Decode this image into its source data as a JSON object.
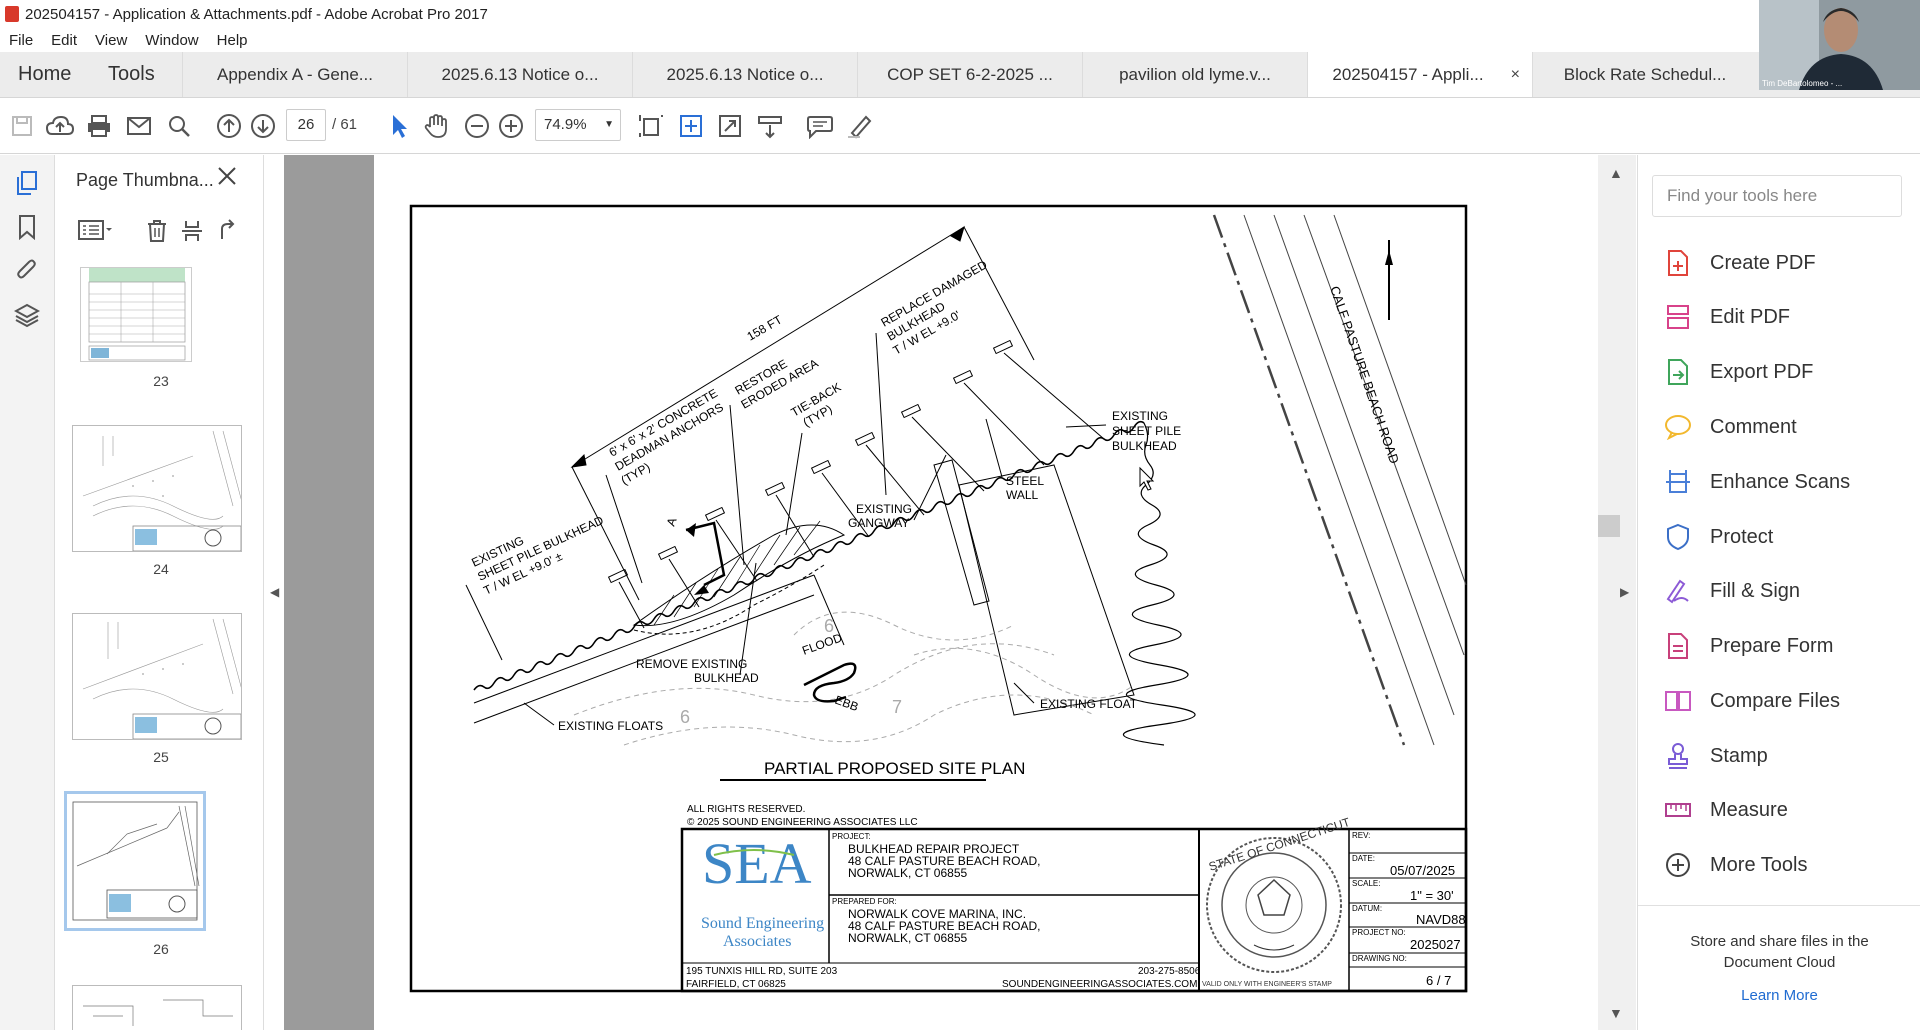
{
  "window": {
    "title": "202504157 - Application & Attachments.pdf - Adobe Acrobat Pro 2017"
  },
  "menu": [
    "File",
    "Edit",
    "View",
    "Window",
    "Help"
  ],
  "tabs": {
    "home": "Home",
    "tools": "Tools",
    "documents": [
      {
        "label": "Appendix A - Gene..."
      },
      {
        "label": "2025.6.13 Notice o..."
      },
      {
        "label": "2025.6.13 Notice o..."
      },
      {
        "label": "COP SET 6-2-2025 ..."
      },
      {
        "label": "pavilion old lyme.v..."
      },
      {
        "label": "202504157 - Appli...",
        "close": "×"
      },
      {
        "label": "Block Rate Schedul..."
      }
    ]
  },
  "toolbar": {
    "page_current": "26",
    "page_total": "/  61",
    "zoom": "74.9%"
  },
  "thumbnails": {
    "title": "Page Thumbna...",
    "pages": [
      "23",
      "24",
      "25",
      "26"
    ]
  },
  "drawing": {
    "length_dim": "158 FT",
    "callouts": {
      "existing_bulkhead_left": [
        "EXISTING",
        "SHEET PILE BULKHEAD",
        "T / W EL +9.0' ±"
      ],
      "deadman": [
        "6' x 6' x 2' CONCRETE",
        "DEADMAN ANCHORS",
        "(TYP)"
      ],
      "restore": [
        "RESTORE",
        "ERODED AREA"
      ],
      "tieback": [
        "TIE-BACK",
        "(TYP)"
      ],
      "replace": [
        "REPLACE DAMAGED",
        "BULKHEAD",
        "T / W EL +9.0'"
      ],
      "existing_bulkhead_right": [
        "EXISTING",
        "SHEET PILE",
        "BULKHEAD"
      ],
      "steel_wall": [
        "STEEL",
        "WALL"
      ],
      "gangway": [
        "EXISTING",
        "GANGWAY"
      ],
      "remove": [
        "REMOVE EXISTING",
        "BULKHEAD"
      ],
      "floats": "EXISTING FLOATS",
      "float": "EXISTING FLOAT",
      "flood": "FLOOD",
      "ebb": "EBB",
      "road": "CALF PASTURE BEACH ROAD",
      "contour_6a": "6",
      "contour_6b": "6",
      "contour_7": "7",
      "section_mark": "A"
    },
    "plan_title": "PARTIAL PROPOSED SITE PLAN",
    "rights": [
      "ALL RIGHTS RESERVED.",
      "© 2025 SOUND ENGINEERING ASSOCIATES LLC"
    ]
  },
  "titleblock": {
    "logo": "SEA",
    "company": [
      "Sound Engineering",
      "Associates"
    ],
    "project_label": "PROJECT:",
    "project": [
      "BULKHEAD REPAIR PROJECT",
      "48 CALF PASTURE BEACH ROAD,",
      "NORWALK, CT 06855"
    ],
    "prepared_label": "PREPARED FOR:",
    "prepared": [
      "NORWALK COVE MARINA, INC.",
      "48 CALF PASTURE BEACH ROAD,",
      "NORWALK, CT 06855"
    ],
    "address": [
      "195 TUNXIS HILL RD, SUITE 203",
      "FAIRFIELD, CT  06825"
    ],
    "phone": "203-275-8506",
    "web": "SOUNDENGINEERINGASSOCIATES.COM",
    "stamp_note": "VALID ONLY WITH ENGINEER'S STAMP",
    "rev_label": "REV:",
    "date_label": "DATE:",
    "date": "05/07/2025",
    "scale_label": "SCALE:",
    "scale": "1\" = 30'",
    "datum_label": "DATUM:",
    "datum": "NAVD88",
    "projno_label": "PROJECT NO:",
    "projno": "2025027",
    "drawno_label": "DRAWING NO:",
    "drawno": "6 / 7",
    "stamp_text": "STATE OF CONNECTICUT"
  },
  "tools_pane": {
    "search_placeholder": "Find your tools here",
    "items": [
      {
        "label": "Create PDF",
        "icon": "create-pdf-icon",
        "color": "#e0443b"
      },
      {
        "label": "Edit PDF",
        "icon": "edit-pdf-icon",
        "color": "#d8428a"
      },
      {
        "label": "Export PDF",
        "icon": "export-pdf-icon",
        "color": "#3fa55b"
      },
      {
        "label": "Comment",
        "icon": "comment-icon",
        "color": "#f2b82e"
      },
      {
        "label": "Enhance Scans",
        "icon": "enhance-scans-icon",
        "color": "#4a7fd8"
      },
      {
        "label": "Protect",
        "icon": "protect-icon",
        "color": "#3b6fc7"
      },
      {
        "label": "Fill & Sign",
        "icon": "fill-sign-icon",
        "color": "#8c5ad6"
      },
      {
        "label": "Prepare Form",
        "icon": "prepare-form-icon",
        "color": "#c8407a"
      },
      {
        "label": "Compare Files",
        "icon": "compare-files-icon",
        "color": "#c858c0"
      },
      {
        "label": "Stamp",
        "icon": "stamp-icon",
        "color": "#7a5cd6"
      },
      {
        "label": "Measure",
        "icon": "measure-icon",
        "color": "#b03f8f"
      },
      {
        "label": "More Tools",
        "icon": "more-tools-icon",
        "color": "#444444"
      }
    ],
    "cloud_text": [
      "Store and share files in the",
      "Document Cloud"
    ],
    "learn_more": "Learn More"
  },
  "webcam": {
    "label": "Tim DeBartolomeo - ..."
  }
}
